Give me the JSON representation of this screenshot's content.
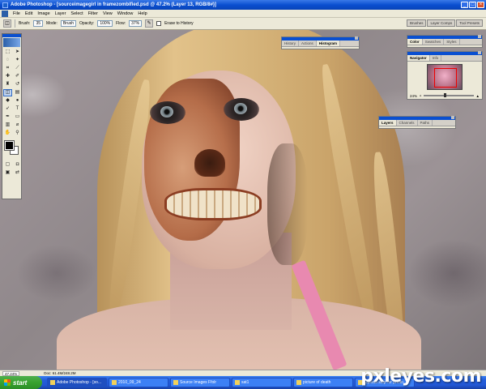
{
  "window": {
    "title": "Adobe Photoshop - [sourceimagegirl in framezombified.psd @ 47.2% (Layer 13, RGB/8#)]",
    "controls": [
      "_",
      "□",
      "×"
    ]
  },
  "menu": [
    "File",
    "Edit",
    "Image",
    "Layer",
    "Select",
    "Filter",
    "View",
    "Window",
    "Help"
  ],
  "options_bar": {
    "brush_label": "Brush:",
    "brush_size": "35",
    "mode_label": "Mode:",
    "mode_value": "Brush",
    "opacity_label": "Opacity:",
    "opacity_value": "100%",
    "flow_label": "Flow:",
    "flow_value": "37%",
    "erase_to_history": "Erase to History"
  },
  "palette_well": [
    "Brushes",
    "Layer Comps",
    "Tool Presets"
  ],
  "palettes": {
    "history": {
      "tabs": [
        "History",
        "Actions",
        "Histogram"
      ]
    },
    "color": {
      "tabs": [
        "Color",
        "Swatches",
        "Styles"
      ]
    },
    "navigator": {
      "tabs": [
        "Navigator",
        "Info"
      ],
      "zoom": "24%"
    },
    "layers": {
      "tabs": [
        "Layers",
        "Channels",
        "Paths"
      ]
    }
  },
  "status_bar": {
    "zoom": "47.24%",
    "doc": "Doc: 61.4M/248.2M"
  },
  "taskbar": {
    "start_label": "start",
    "buttons": [
      "Adobe Photoshop - [so...",
      "2010_09_24",
      "Source Images Ffolr",
      "sat1",
      "picture of death",
      "Upload step for photo..."
    ]
  },
  "watermark": "pxleyes.com",
  "colors": {
    "title_bar": "#0a4fd0",
    "taskbar": "#245edb",
    "start_button": "#37a12f",
    "chrome": "#ece9d8",
    "strap_pink": "#e889b0"
  }
}
